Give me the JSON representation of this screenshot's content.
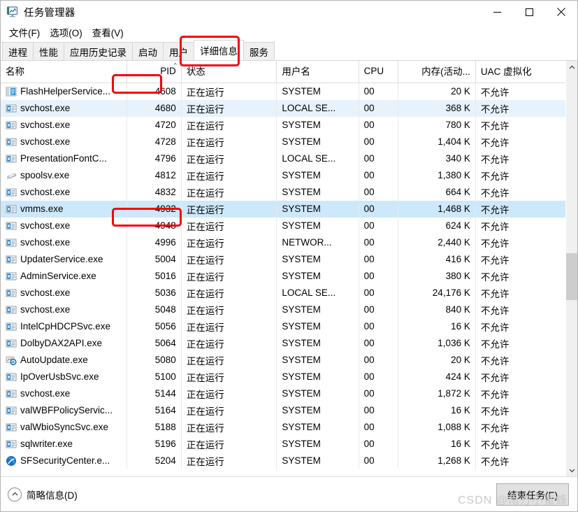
{
  "window": {
    "title": "任务管理器",
    "icon": "task-manager-icon",
    "controls": {
      "minimize": "—",
      "maximize": "▢",
      "close": "✕"
    }
  },
  "menu": [
    {
      "label": "文件(F)",
      "name": "menu-file"
    },
    {
      "label": "选项(O)",
      "name": "menu-options"
    },
    {
      "label": "查看(V)",
      "name": "menu-view"
    }
  ],
  "tabs": [
    {
      "label": "进程",
      "active": false
    },
    {
      "label": "性能",
      "active": false
    },
    {
      "label": "应用历史记录",
      "active": false
    },
    {
      "label": "启动",
      "active": false
    },
    {
      "label": "用户",
      "active": false
    },
    {
      "label": "详细信息",
      "active": true
    },
    {
      "label": "服务",
      "active": false
    }
  ],
  "table": {
    "columns": [
      {
        "label": "名称",
        "align": "left"
      },
      {
        "label": "PID",
        "align": "right",
        "sort": "asc",
        "sort_glyph": "^"
      },
      {
        "label": "状态",
        "align": "left"
      },
      {
        "label": "用户名",
        "align": "left"
      },
      {
        "label": "CPU",
        "align": "left"
      },
      {
        "label": "内存(活动...",
        "align": "right"
      },
      {
        "label": "UAC 虚拟化",
        "align": "left"
      }
    ],
    "rows": [
      {
        "icon": "flash-helper-icon",
        "name": "FlashHelperService...",
        "pid": "4608",
        "status": "正在运行",
        "user": "SYSTEM",
        "cpu": "00",
        "memory": "20 K",
        "uac": "不允许",
        "style": ""
      },
      {
        "icon": "svchost-icon",
        "name": "svchost.exe",
        "pid": "4680",
        "status": "正在运行",
        "user": "LOCAL SE...",
        "cpu": "00",
        "memory": "368 K",
        "uac": "不允许",
        "style": "alt"
      },
      {
        "icon": "svchost-icon",
        "name": "svchost.exe",
        "pid": "4720",
        "status": "正在运行",
        "user": "SYSTEM",
        "cpu": "00",
        "memory": "780 K",
        "uac": "不允许",
        "style": ""
      },
      {
        "icon": "svchost-icon",
        "name": "svchost.exe",
        "pid": "4728",
        "status": "正在运行",
        "user": "SYSTEM",
        "cpu": "00",
        "memory": "1,404 K",
        "uac": "不允许",
        "style": ""
      },
      {
        "icon": "svchost-icon",
        "name": "PresentationFontC...",
        "pid": "4796",
        "status": "正在运行",
        "user": "LOCAL SE...",
        "cpu": "00",
        "memory": "340 K",
        "uac": "不允许",
        "style": ""
      },
      {
        "icon": "printer-icon",
        "name": "spoolsv.exe",
        "pid": "4812",
        "status": "正在运行",
        "user": "SYSTEM",
        "cpu": "00",
        "memory": "1,380 K",
        "uac": "不允许",
        "style": ""
      },
      {
        "icon": "svchost-icon",
        "name": "svchost.exe",
        "pid": "4832",
        "status": "正在运行",
        "user": "SYSTEM",
        "cpu": "00",
        "memory": "664 K",
        "uac": "不允许",
        "style": ""
      },
      {
        "icon": "svchost-icon",
        "name": "vmms.exe",
        "pid": "4932",
        "status": "正在运行",
        "user": "SYSTEM",
        "cpu": "00",
        "memory": "1,468 K",
        "uac": "不允许",
        "style": "sel"
      },
      {
        "icon": "svchost-icon",
        "name": "svchost.exe",
        "pid": "4948",
        "status": "正在运行",
        "user": "SYSTEM",
        "cpu": "00",
        "memory": "624 K",
        "uac": "不允许",
        "style": ""
      },
      {
        "icon": "svchost-icon",
        "name": "svchost.exe",
        "pid": "4996",
        "status": "正在运行",
        "user": "NETWOR...",
        "cpu": "00",
        "memory": "2,440 K",
        "uac": "不允许",
        "style": ""
      },
      {
        "icon": "svchost-icon",
        "name": "UpdaterService.exe",
        "pid": "5004",
        "status": "正在运行",
        "user": "SYSTEM",
        "cpu": "00",
        "memory": "416 K",
        "uac": "不允许",
        "style": ""
      },
      {
        "icon": "svchost-icon",
        "name": "AdminService.exe",
        "pid": "5016",
        "status": "正在运行",
        "user": "SYSTEM",
        "cpu": "00",
        "memory": "380 K",
        "uac": "不允许",
        "style": ""
      },
      {
        "icon": "svchost-icon",
        "name": "svchost.exe",
        "pid": "5036",
        "status": "正在运行",
        "user": "LOCAL SE...",
        "cpu": "00",
        "memory": "24,176 K",
        "uac": "不允许",
        "style": ""
      },
      {
        "icon": "svchost-icon",
        "name": "svchost.exe",
        "pid": "5048",
        "status": "正在运行",
        "user": "SYSTEM",
        "cpu": "00",
        "memory": "840 K",
        "uac": "不允许",
        "style": ""
      },
      {
        "icon": "svchost-icon",
        "name": "IntelCpHDCPSvc.exe",
        "pid": "5056",
        "status": "正在运行",
        "user": "SYSTEM",
        "cpu": "00",
        "memory": "16 K",
        "uac": "不允许",
        "style": ""
      },
      {
        "icon": "svchost-icon",
        "name": "DolbyDAX2API.exe",
        "pid": "5064",
        "status": "正在运行",
        "user": "SYSTEM",
        "cpu": "00",
        "memory": "1,036 K",
        "uac": "不允许",
        "style": ""
      },
      {
        "icon": "autoupdate-icon",
        "name": "AutoUpdate.exe",
        "pid": "5080",
        "status": "正在运行",
        "user": "SYSTEM",
        "cpu": "00",
        "memory": "20 K",
        "uac": "不允许",
        "style": ""
      },
      {
        "icon": "svchost-icon",
        "name": "IpOverUsbSvc.exe",
        "pid": "5100",
        "status": "正在运行",
        "user": "SYSTEM",
        "cpu": "00",
        "memory": "424 K",
        "uac": "不允许",
        "style": ""
      },
      {
        "icon": "svchost-icon",
        "name": "svchost.exe",
        "pid": "5144",
        "status": "正在运行",
        "user": "SYSTEM",
        "cpu": "00",
        "memory": "1,872 K",
        "uac": "不允许",
        "style": ""
      },
      {
        "icon": "svchost-icon",
        "name": "valWBFPolicyServic...",
        "pid": "5164",
        "status": "正在运行",
        "user": "SYSTEM",
        "cpu": "00",
        "memory": "16 K",
        "uac": "不允许",
        "style": ""
      },
      {
        "icon": "svchost-icon",
        "name": "valWbioSyncSvc.exe",
        "pid": "5188",
        "status": "正在运行",
        "user": "SYSTEM",
        "cpu": "00",
        "memory": "1,088 K",
        "uac": "不允许",
        "style": ""
      },
      {
        "icon": "svchost-icon",
        "name": "sqlwriter.exe",
        "pid": "5196",
        "status": "正在运行",
        "user": "SYSTEM",
        "cpu": "00",
        "memory": "16 K",
        "uac": "不允许",
        "style": ""
      },
      {
        "icon": "security-center-icon",
        "name": "SFSecurityCenter.e...",
        "pid": "5204",
        "status": "正在运行",
        "user": "SYSTEM",
        "cpu": "00",
        "memory": "1,268 K",
        "uac": "不允许",
        "style": ""
      }
    ]
  },
  "scrollbar": {
    "up_glyph": "^",
    "down_glyph": "v",
    "thumb_top_pct": 46,
    "thumb_height_pct": 12
  },
  "statusbar": {
    "fewer_details": "简略信息(D)",
    "fewer_details_glyph": "^",
    "end_task": "结束任务(E)"
  },
  "watermark": "CSDN @南方小蜜蜂",
  "colors": {
    "accent": "#0078d7",
    "row_alt": "#e8f2fb",
    "row_selected": "#cde8fa",
    "annotation": "#f5000f",
    "scrollbar_thumb": "#cdcdcd"
  }
}
